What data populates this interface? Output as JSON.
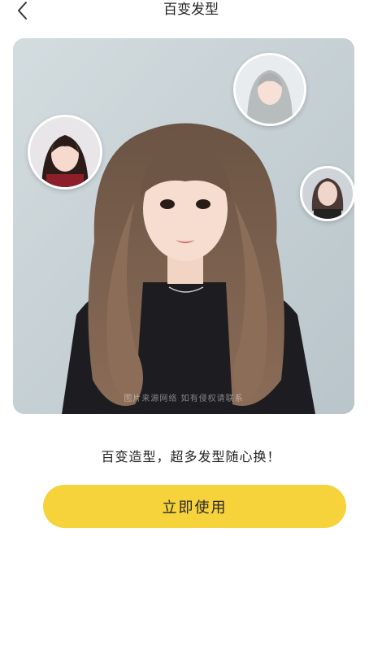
{
  "header": {
    "title": "百变发型",
    "back_icon": "chevron-left-icon"
  },
  "hero": {
    "watermark": "图片来源网络 如有侵权请联系"
  },
  "slogan": "百变造型，超多发型随心换！",
  "cta": {
    "label": "立即使用",
    "color": "#f6d23b"
  },
  "colors": {
    "background": "#ffffff",
    "hero_bg": "#c9d3d7",
    "accent": "#f6d23b"
  }
}
